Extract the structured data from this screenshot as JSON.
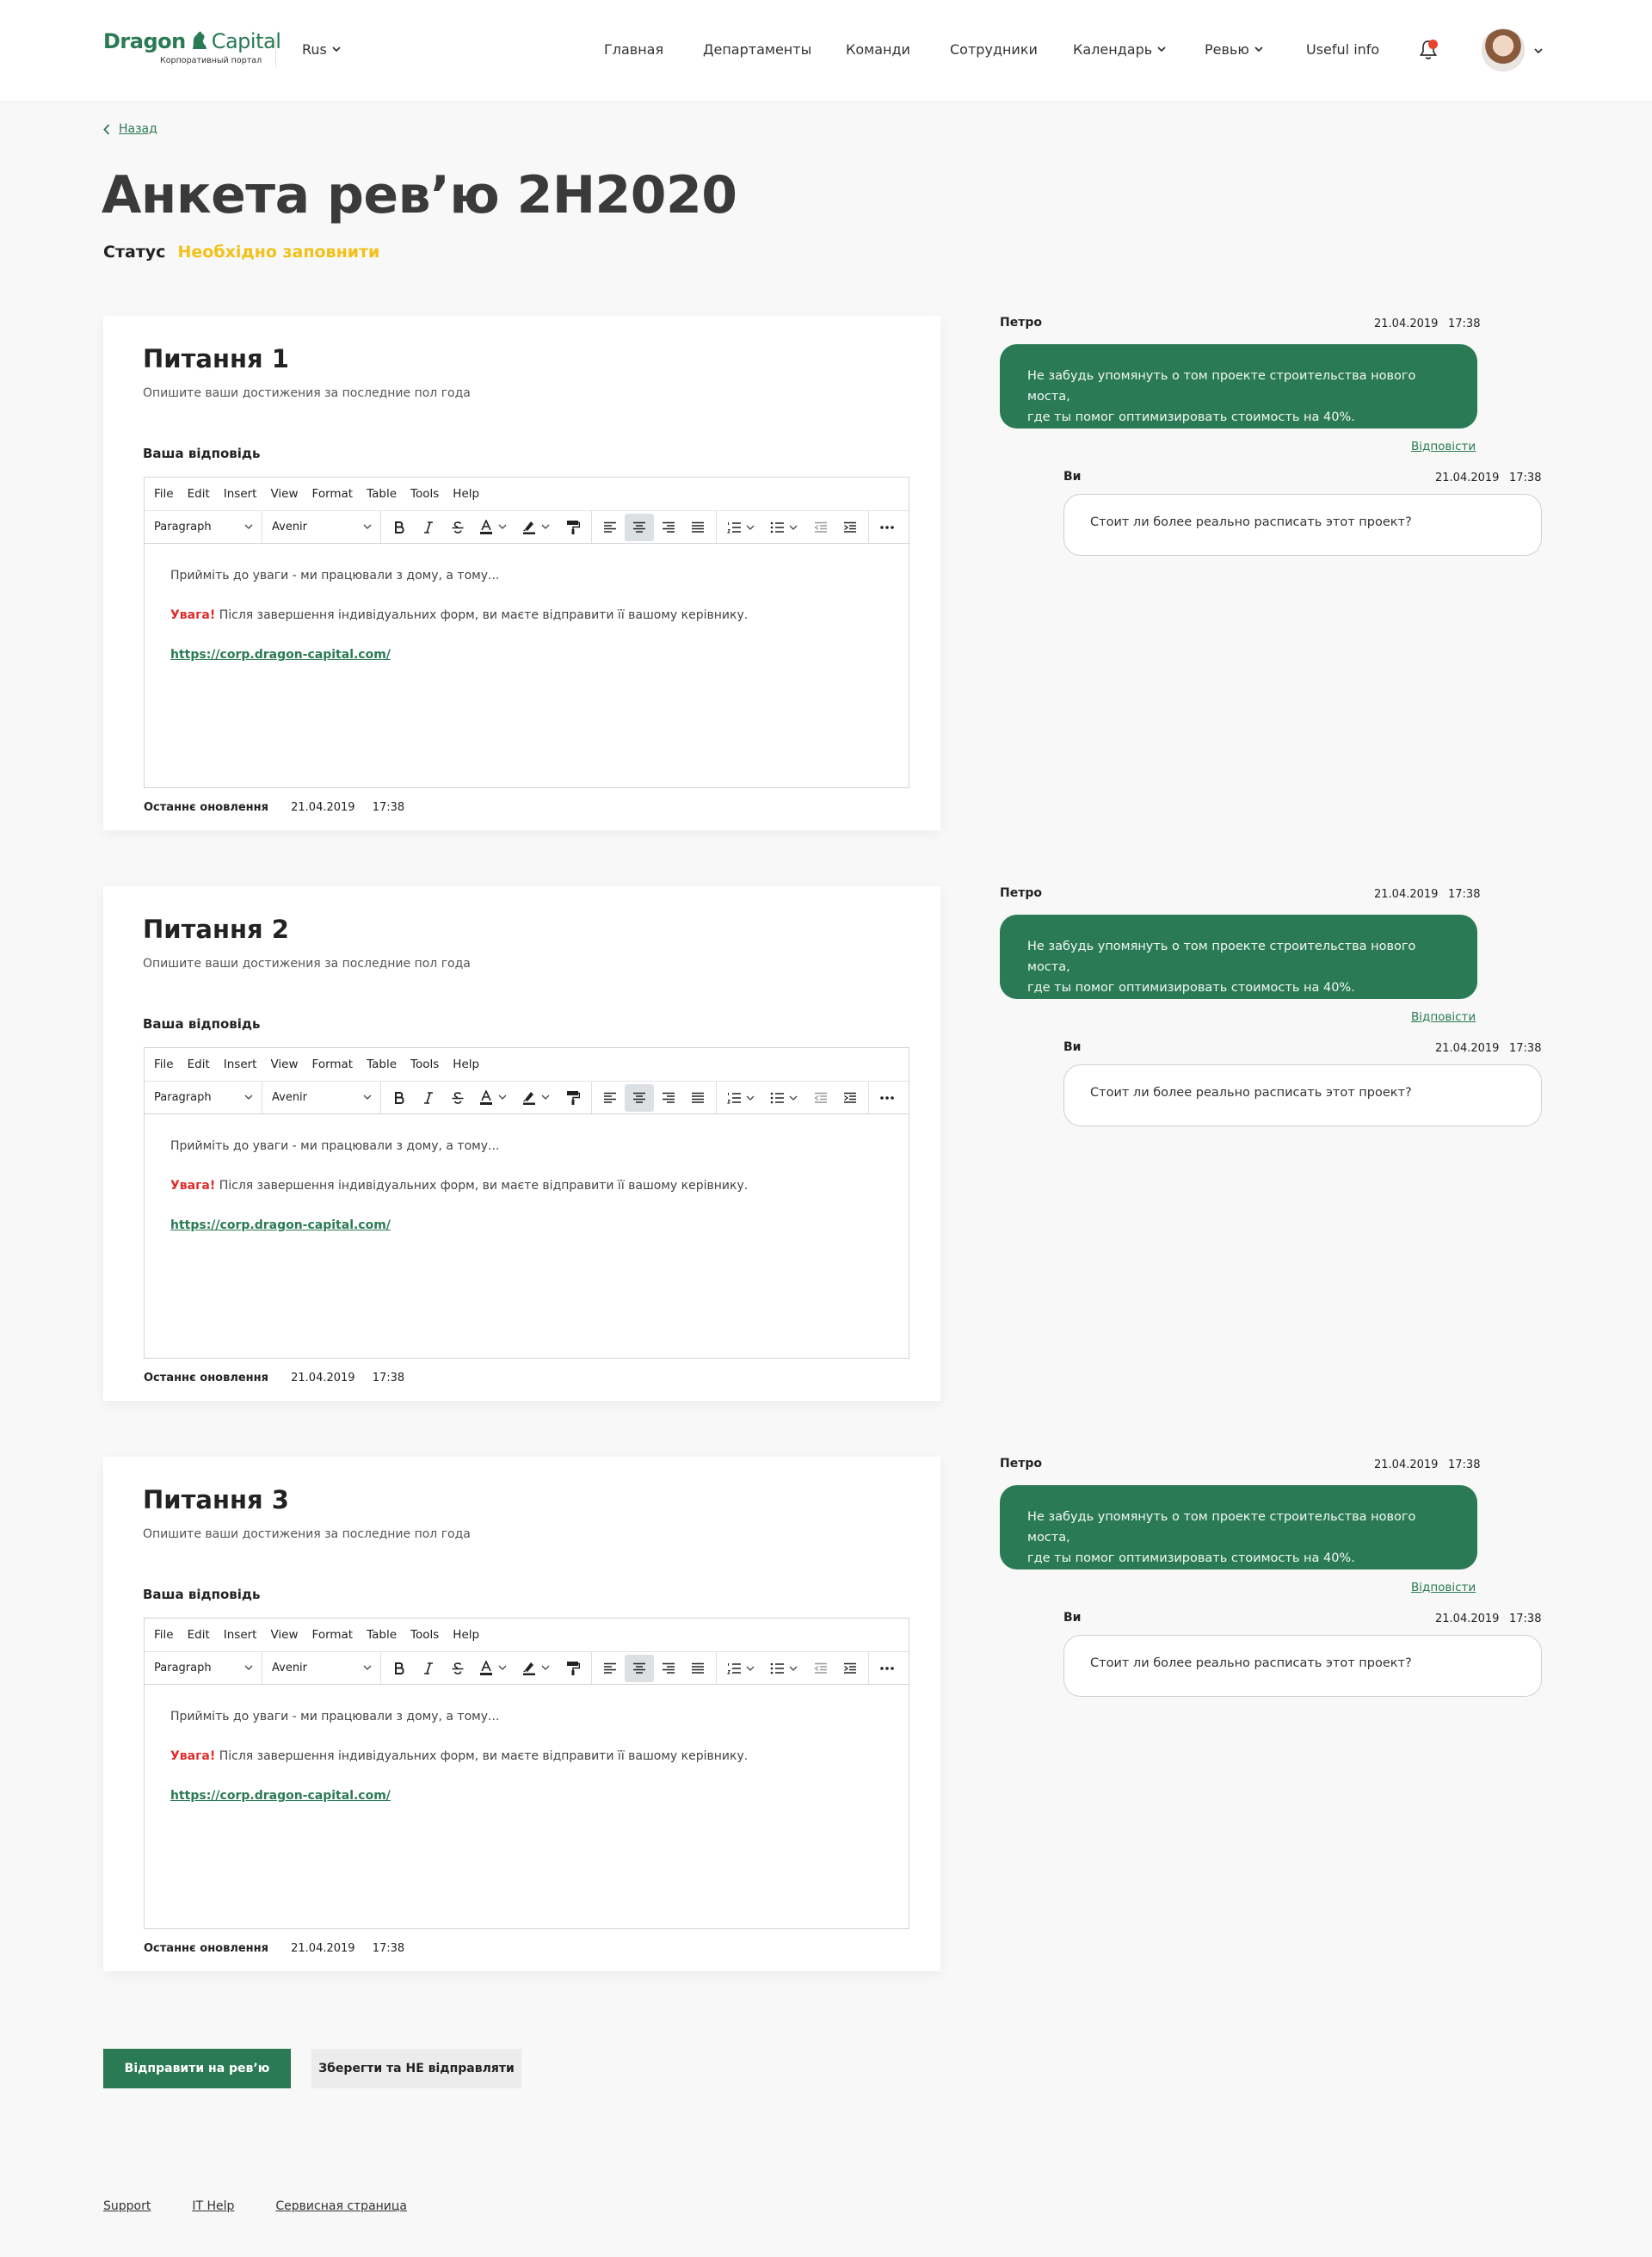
{
  "header": {
    "logo_text_1": "Dragon",
    "logo_text_2": "Capital",
    "logo_subtitle": "Корпоративный портал",
    "language": "Rus",
    "nav": [
      {
        "label": "Главная"
      },
      {
        "label": "Департаменты"
      },
      {
        "label": "Команди"
      },
      {
        "label": "Сотрудники"
      },
      {
        "label": "Календарь"
      },
      {
        "label": "Ревью"
      },
      {
        "label": "Useful info"
      }
    ]
  },
  "page": {
    "back_label": "Назад",
    "title": "Анкета рев’ю 2H2020",
    "status_label": "Статус",
    "status_value": "Необхідно заповнити"
  },
  "editor_ui": {
    "menu": [
      "File",
      "Edit",
      "Insert",
      "View",
      "Format",
      "Table",
      "Tools",
      "Help"
    ],
    "block_format": "Paragraph",
    "font_family": "Avenir"
  },
  "questions": [
    {
      "title": "Питання 1",
      "description": "Опишите ваши достижения за последние пол года",
      "answer_label": "Ваша відповідь",
      "line1": "Прийміть до уваги - ми працювали з дому, а тому...",
      "warn": "Увага!",
      "line2": " Після завершення індивідуальних форм, ви маєте відправити її вашому керівнику.",
      "link": "https://corp.dragon-capital.com/",
      "updated_label": "Останнє оновлення",
      "updated_date": "21.04.2019",
      "updated_time": "17:38",
      "comment": {
        "author": "Петро",
        "date": "21.04.2019",
        "time": "17:38",
        "text_1": "Не забудь упомянуть о том проекте строительства нового моста,",
        "text_2": "где ты помог оптимизировать стоимость на 40%.",
        "reply_label": "Відповісти",
        "reply_author": "Ви",
        "reply_date": "21.04.2019",
        "reply_time": "17:38",
        "reply_text": "Стоит ли более реально расписать этот проект?"
      }
    },
    {
      "title": "Питання 2",
      "description": "Опишите ваши достижения за последние пол года",
      "answer_label": "Ваша відповідь",
      "line1": "Прийміть до уваги - ми працювали з дому, а тому...",
      "warn": "Увага!",
      "line2": " Після завершення індивідуальних форм, ви маєте відправити її вашому керівнику.",
      "link": "https://corp.dragon-capital.com/",
      "updated_label": "Останнє оновлення",
      "updated_date": "21.04.2019",
      "updated_time": "17:38",
      "comment": {
        "author": "Петро",
        "date": "21.04.2019",
        "time": "17:38",
        "text_1": "Не забудь упомянуть о том проекте строительства нового моста,",
        "text_2": "где ты помог оптимизировать стоимость на 40%.",
        "reply_label": "Відповісти",
        "reply_author": "Ви",
        "reply_date": "21.04.2019",
        "reply_time": "17:38",
        "reply_text": "Стоит ли более реально расписать этот проект?"
      }
    },
    {
      "title": "Питання 3",
      "description": "Опишите ваши достижения за последние пол года",
      "answer_label": "Ваша відповідь",
      "line1": "Прийміть до уваги - ми працювали з дому, а тому...",
      "warn": "Увага!",
      "line2": " Після завершення індивідуальних форм, ви маєте відправити її вашому керівнику.",
      "link": "https://corp.dragon-capital.com/",
      "updated_label": "Останнє оновлення",
      "updated_date": "21.04.2019",
      "updated_time": "17:38",
      "comment": {
        "author": "Петро",
        "date": "21.04.2019",
        "time": "17:38",
        "text_1": "Не забудь упомянуть о том проекте строительства нового моста,",
        "text_2": "где ты помог оптимизировать стоимость на 40%.",
        "reply_label": "Відповісти",
        "reply_author": "Ви",
        "reply_date": "21.04.2019",
        "reply_time": "17:38",
        "reply_text": "Стоит ли более реально расписать этот проект?"
      }
    }
  ],
  "actions": {
    "submit_label": "Відправити на рев’ю",
    "save_label": "Зберегти та НЕ відправляти"
  },
  "footer": {
    "links": [
      "Support",
      "IT Help",
      "Сервисная страница"
    ]
  },
  "colors": {
    "brand_green": "#2a7a55",
    "status_yellow": "#f2c11a",
    "warning_red": "#e02b2b",
    "notification_dot": "#e8432c"
  },
  "icons": {
    "logo": "dragon-icon",
    "notifications": "bell-icon",
    "back": "chevron-left-icon",
    "dropdown": "chevron-down-icon"
  }
}
